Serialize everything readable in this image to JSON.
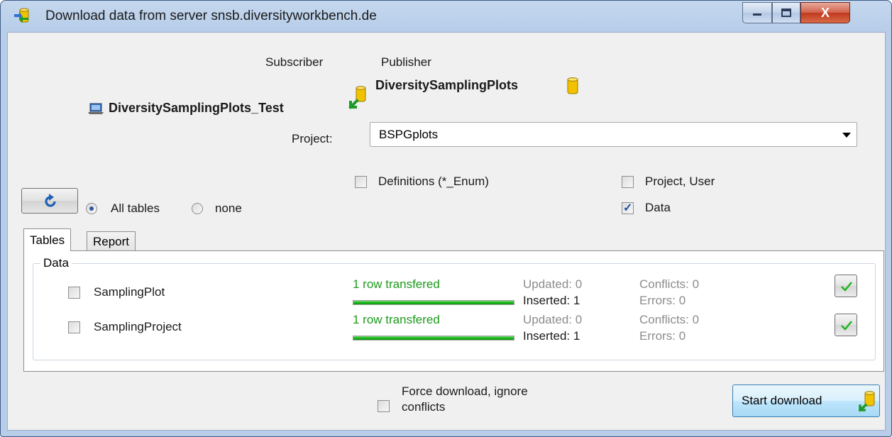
{
  "window": {
    "title": "Download data from server snsb.diversityworkbench.de",
    "controls": {
      "minimize": "minimize",
      "maximize": "maximize",
      "close": "X"
    }
  },
  "header": {
    "subscriber_label": "Subscriber",
    "publisher_label": "Publisher",
    "subscriber_db": "DiversitySamplingPlots_Test",
    "publisher_db": "DiversitySamplingPlots"
  },
  "project": {
    "label": "Project:",
    "value": "BSPGplots"
  },
  "options": {
    "definitions": {
      "label": "Definitions (*_Enum)",
      "checked": false
    },
    "project_user": {
      "label": "Project, User",
      "checked": false
    },
    "data": {
      "label": "Data",
      "checked": true
    }
  },
  "selection": {
    "all_tables": {
      "label": "All tables",
      "selected": true
    },
    "none": {
      "label": "none",
      "selected": false
    }
  },
  "tabs": [
    {
      "label": "Tables",
      "active": true
    },
    {
      "label": "Report",
      "active": false
    }
  ],
  "group": {
    "label": "Data"
  },
  "tables": [
    {
      "name": "SamplingPlot",
      "checked": false,
      "status": "1 row transfered",
      "progress": 1.0,
      "updated": "Updated: 0",
      "inserted": "Inserted: 1",
      "conflicts": "Conflicts: 0",
      "errors": "Errors: 0"
    },
    {
      "name": "SamplingProject",
      "checked": false,
      "status": "1 row transfered",
      "progress": 1.0,
      "updated": "Updated: 0",
      "inserted": "Inserted: 1",
      "conflicts": "Conflicts: 0",
      "errors": "Errors: 0"
    }
  ],
  "footer": {
    "force_download": {
      "label_line1": "Force download, ignore",
      "label_line2": "conflicts",
      "checked": false
    },
    "start_button": "Start download"
  },
  "colors": {
    "accent": "#1c9a1c",
    "progress": "#19b219",
    "db_icon": "#f2c200"
  },
  "icons": {
    "app": "sync-database-icon",
    "refresh": "refresh-icon",
    "laptop": "laptop-icon",
    "database": "database-icon",
    "arrow": "download-arrow-icon",
    "ok": "checkmark-icon"
  }
}
